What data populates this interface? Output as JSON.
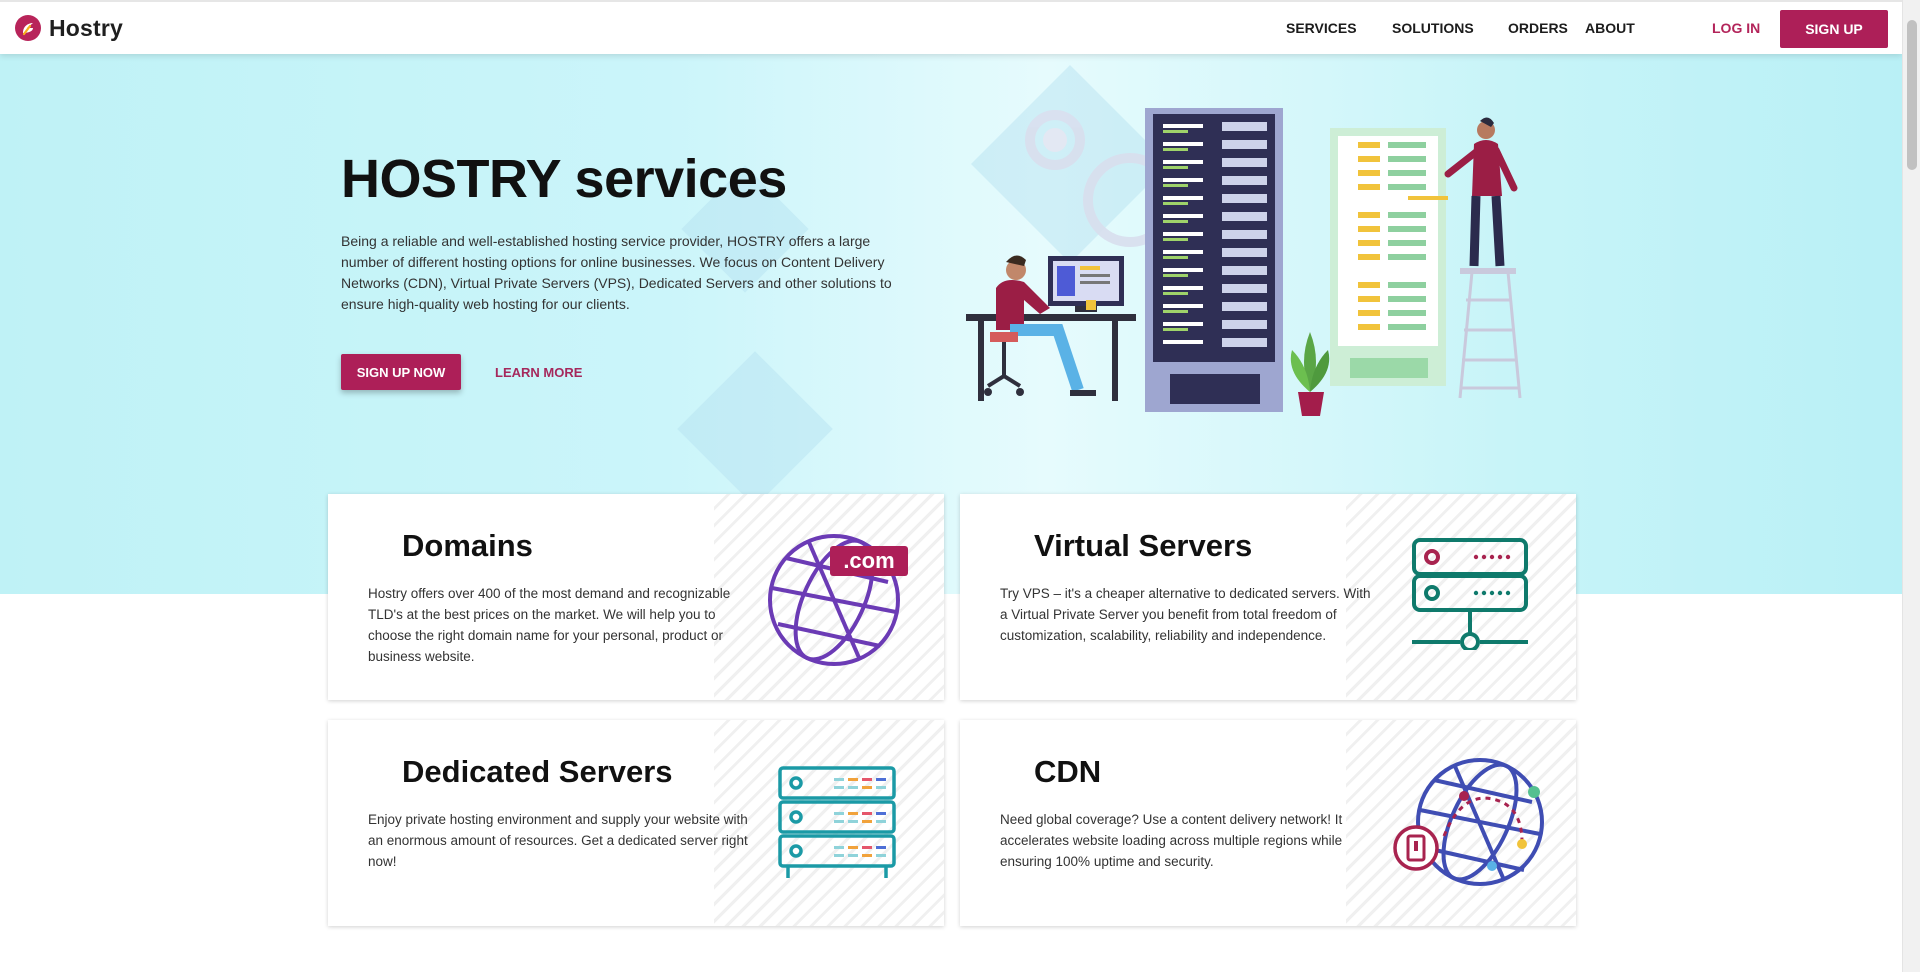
{
  "brand": {
    "name": "Hostry"
  },
  "nav": {
    "services": "SERVICES",
    "solutions": "SOLUTIONS",
    "orders": "ORDERS",
    "about": "ABOUT",
    "login": "LOG IN",
    "signup": "SIGN UP"
  },
  "hero": {
    "title": "HOSTRY services",
    "description": "Being a reliable and well-established hosting service provider, HOSTRY offers a large number of different hosting options for online businesses. We focus on Content Delivery Networks (CDN), Virtual Private Servers (VPS), Dedicated Servers and other solutions to ensure high-quality web hosting for our clients.",
    "cta_primary": "SIGN UP NOW",
    "cta_secondary": "LEARN MORE"
  },
  "services": [
    {
      "title": "Domains",
      "text": "Hostry offers over 400 of the most demand and recognizable TLD's at the best prices on the market. We will help you to choose the right domain name for your personal, product or business website.",
      "icon": "globe-com-icon",
      "badge": ".com"
    },
    {
      "title": "Virtual Servers",
      "text": "Try VPS – it's a cheaper alternative to dedicated servers. With a Virtual Private Server you benefit from total freedom of customization, scalability, reliability and independence.",
      "icon": "vps-server-icon"
    },
    {
      "title": "Dedicated Servers",
      "text": "Enjoy private hosting environment and supply your website with an enormous amount of resources. Get a dedicated server right now!",
      "icon": "server-rack-icon"
    },
    {
      "title": "CDN",
      "text": "Need global coverage? Use a content delivery network! It accelerates website loading across multiple regions while ensuring 100% uptime and security.",
      "icon": "cdn-globe-icon"
    }
  ],
  "colors": {
    "accent": "#ad1f58",
    "domains_icon": "#6b3bb5",
    "vps_icon": "#0f7a6c",
    "dedicated_icon": "#1b9aa6",
    "cdn_icon": "#3f4db3"
  }
}
